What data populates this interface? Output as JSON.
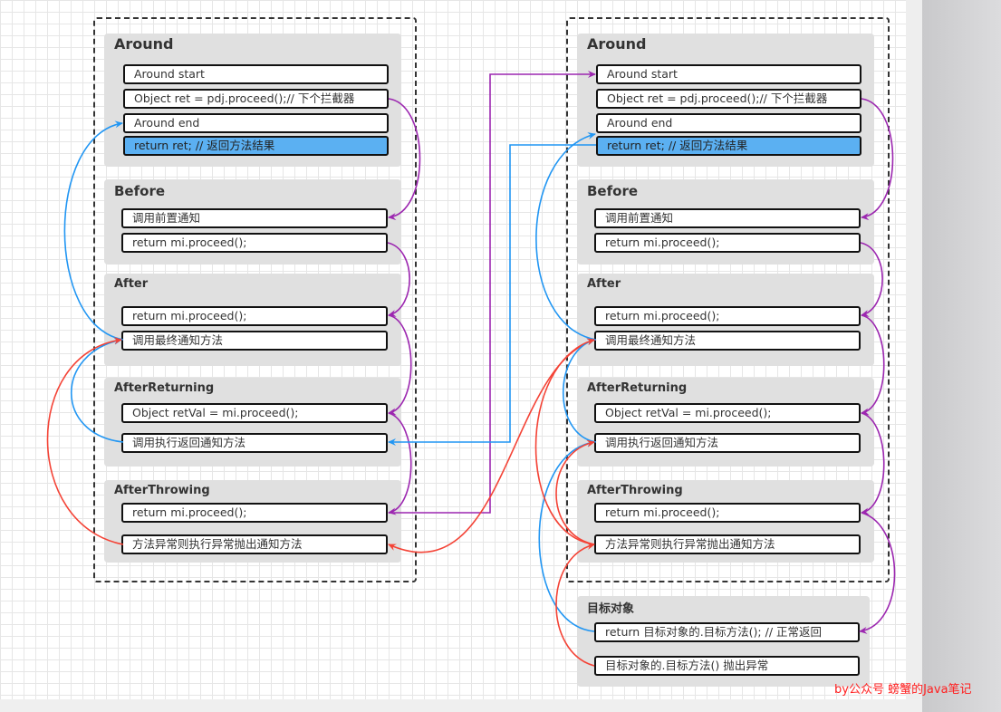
{
  "colors": {
    "call": "#9c27b0",
    "return": "#2196f3",
    "exception": "#f44336",
    "highlight": "#5bb0f2"
  },
  "columns": [
    {
      "groups": [
        {
          "title": "Around",
          "items": [
            "Around start",
            "Object ret = pdj.proceed();// 下个拦截器",
            "Around end",
            "return ret; // 返回方法结果"
          ]
        },
        {
          "title": "Before",
          "items": [
            "调用前置通知",
            "return mi.proceed();"
          ]
        },
        {
          "title": "After",
          "items": [
            "return mi.proceed();",
            "调用最终通知方法"
          ]
        },
        {
          "title": "AfterReturning",
          "items": [
            "Object retVal = mi.proceed();",
            "调用执行返回通知方法"
          ]
        },
        {
          "title": "AfterThrowing",
          "items": [
            "return mi.proceed();",
            "方法异常则执行异常抛出通知方法"
          ]
        }
      ]
    },
    {
      "groups": [
        {
          "title": "Around",
          "items": [
            "Around start",
            "Object ret = pdj.proceed();// 下个拦截器",
            "Around end",
            "return ret; // 返回方法结果"
          ]
        },
        {
          "title": "Before",
          "items": [
            "调用前置通知",
            "return mi.proceed();"
          ]
        },
        {
          "title": "After",
          "items": [
            "return mi.proceed();",
            "调用最终通知方法"
          ]
        },
        {
          "title": "AfterReturning",
          "items": [
            "Object retVal = mi.proceed();",
            "调用执行返回通知方法"
          ]
        },
        {
          "title": "AfterThrowing",
          "items": [
            "return mi.proceed();",
            "方法异常则执行异常抛出通知方法"
          ]
        }
      ]
    }
  ],
  "target": {
    "title": "目标对象",
    "items": [
      "return 目标对象的.目标方法(); // 正常返回",
      "目标对象的.目标方法() 抛出异常"
    ]
  },
  "watermark": "by公众号  螃蟹的Java笔记"
}
